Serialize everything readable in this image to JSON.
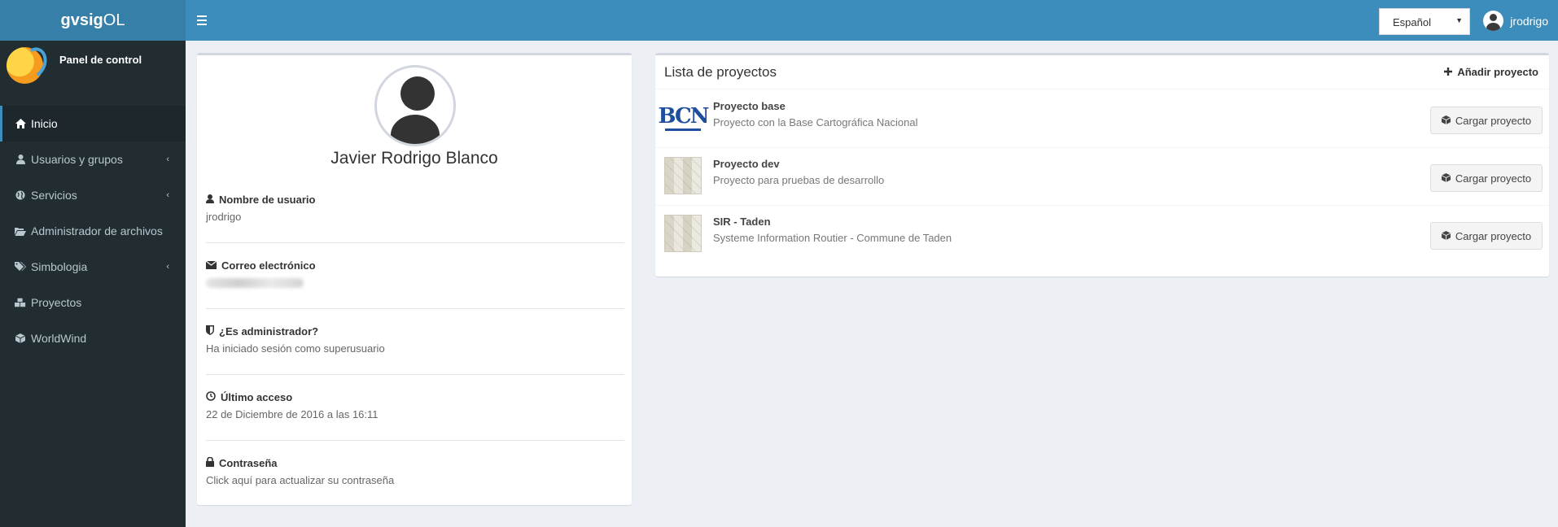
{
  "app": {
    "logo_bold": "gvsig",
    "logo_light": "OL"
  },
  "header": {
    "language": "Español",
    "username": "jrodrigo"
  },
  "sidebar": {
    "panel_title": "Panel de control",
    "items": [
      {
        "label": "Inicio",
        "icon": "home-icon",
        "active": true
      },
      {
        "label": "Usuarios y grupos",
        "icon": "user-icon",
        "submenu": true
      },
      {
        "label": "Servicios",
        "icon": "globe-icon",
        "submenu": true
      },
      {
        "label": "Administrador de archivos",
        "icon": "folder-open-icon"
      },
      {
        "label": "Simbologia",
        "icon": "tags-icon",
        "submenu": true
      },
      {
        "label": "Proyectos",
        "icon": "cubes-icon"
      },
      {
        "label": "WorldWind",
        "icon": "cube-icon"
      }
    ]
  },
  "profile": {
    "name": "Javier Rodrigo Blanco",
    "username_label": "Nombre de usuario",
    "username_value": "jrodrigo",
    "email_label": "Correo electrónico",
    "admin_label": "¿Es administrador?",
    "admin_value": "Ha iniciado sesión como superusuario",
    "last_access_label": "Último acceso",
    "last_access_value": "22 de Diciembre de 2016 a las 16:11",
    "password_label": "Contraseña",
    "password_value": "Click aquí para actualizar su contraseña"
  },
  "projects": {
    "title": "Lista de proyectos",
    "add_label": "Añadir proyecto",
    "load_label": "Cargar proyecto",
    "items": [
      {
        "name": "Proyecto base",
        "description": "Proyecto con la Base Cartográfica Nacional",
        "thumb_text": "BCN"
      },
      {
        "name": "Proyecto dev",
        "description": "Proyecto para pruebas de desarrollo"
      },
      {
        "name": "SIR - Taden",
        "description": "Systeme Information Routier - Commune de Taden"
      }
    ]
  },
  "colors": {
    "header": "#3c8dbc",
    "logo_bg": "#367fa9",
    "sidebar": "#222d32",
    "body": "#ecf0f5"
  }
}
